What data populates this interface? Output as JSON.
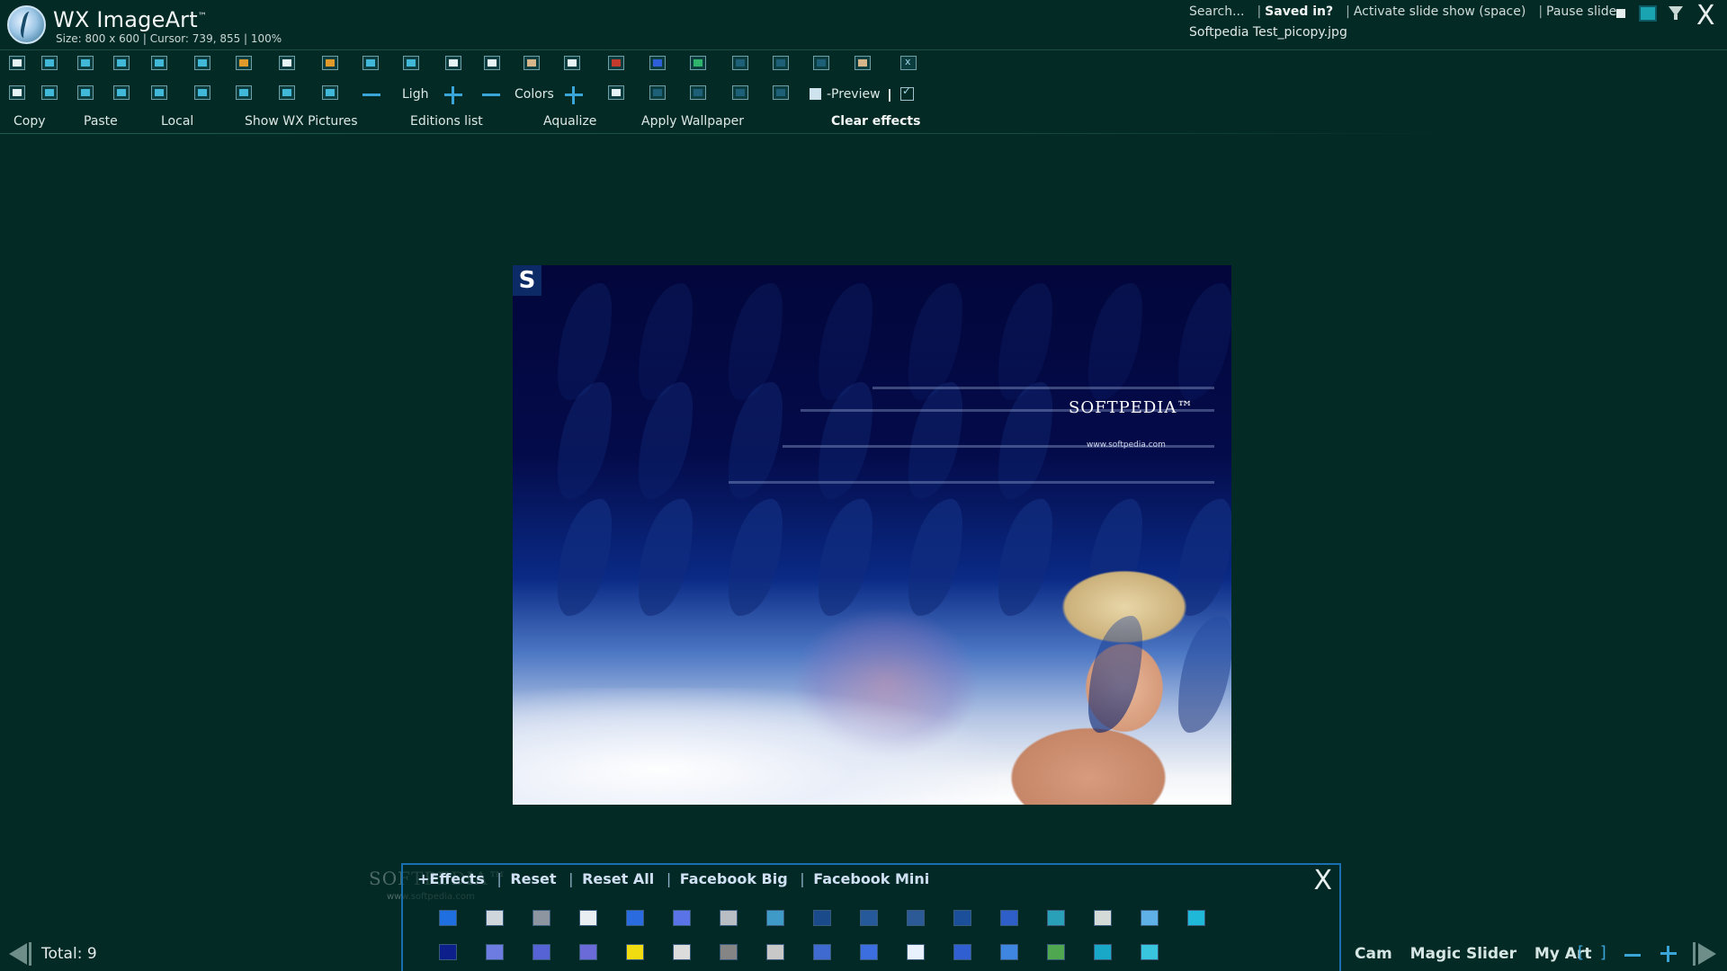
{
  "header": {
    "title": "WX ImageArt",
    "trademark": "™",
    "status": "Size: 800 x 600 | Cursor: 739, 855 | 100%",
    "filename": "Softpedia Test_picopy.jpg",
    "links": {
      "search": "Search...",
      "saved_in": "Saved in?",
      "slideshow": "Activate slide show (space)",
      "pause": "Pause slide"
    },
    "close_label": "X"
  },
  "toolbar": {
    "light_label": "Ligh",
    "colors_label": "Colors",
    "preview_label": "-Preview",
    "labels": {
      "copy": "Copy",
      "paste": "Paste",
      "local": "Local",
      "show_wx": "Show WX Pictures",
      "editions": "Editions list",
      "aqualize": "Aqualize",
      "wallpaper": "Apply Wallpaper",
      "clear": "Clear effects"
    }
  },
  "canvas": {
    "badge": "S",
    "brand": "SOFTPEDIA™",
    "brand_url": "www.softpedia.com"
  },
  "watermark": {
    "text": "SOFTPEDIA™",
    "url": "www.softpedia.com"
  },
  "effects": {
    "links": {
      "effects": "+Effects",
      "reset": "Reset",
      "reset_all": "Reset All",
      "fb_big": "Facebook Big",
      "fb_mini": "Facebook Mini"
    },
    "close_label": "X",
    "row1_colors": [
      "#1f6fe0",
      "#cfd6dc",
      "#8d96a0",
      "#e9eef2",
      "#2a6be0",
      "#5a74e8",
      "#b9bec4",
      "#3f9ac8",
      "#1b4a8a",
      "#26599a",
      "#2c5a96",
      "#1c4f9a",
      "#2e5ec8",
      "#2aa0b8",
      "#d4dad8",
      "#5fb0e6",
      "#1fb8d8"
    ],
    "row2_colors": [
      "#0d1f8a",
      "#6d7ce0",
      "#5563d4",
      "#6a6ad8",
      "#f0dc10",
      "#dcdcdc",
      "#858585",
      "#c8c8c8",
      "#3f6ad0",
      "#3c6ee0",
      "#e9f1ff",
      "#2f5fd0",
      "#3f86e0",
      "#4fa850",
      "#1aa8c8",
      "#39c5de"
    ]
  },
  "footer": {
    "total": "Total: 9",
    "cam": "Cam",
    "magic_slider": "Magic Slider",
    "my_art": "My Art",
    "brackets": "[ ]"
  },
  "colors": {
    "background": "#042a26",
    "accent": "#3aa5d9",
    "panel_border": "#1a6fb0"
  }
}
